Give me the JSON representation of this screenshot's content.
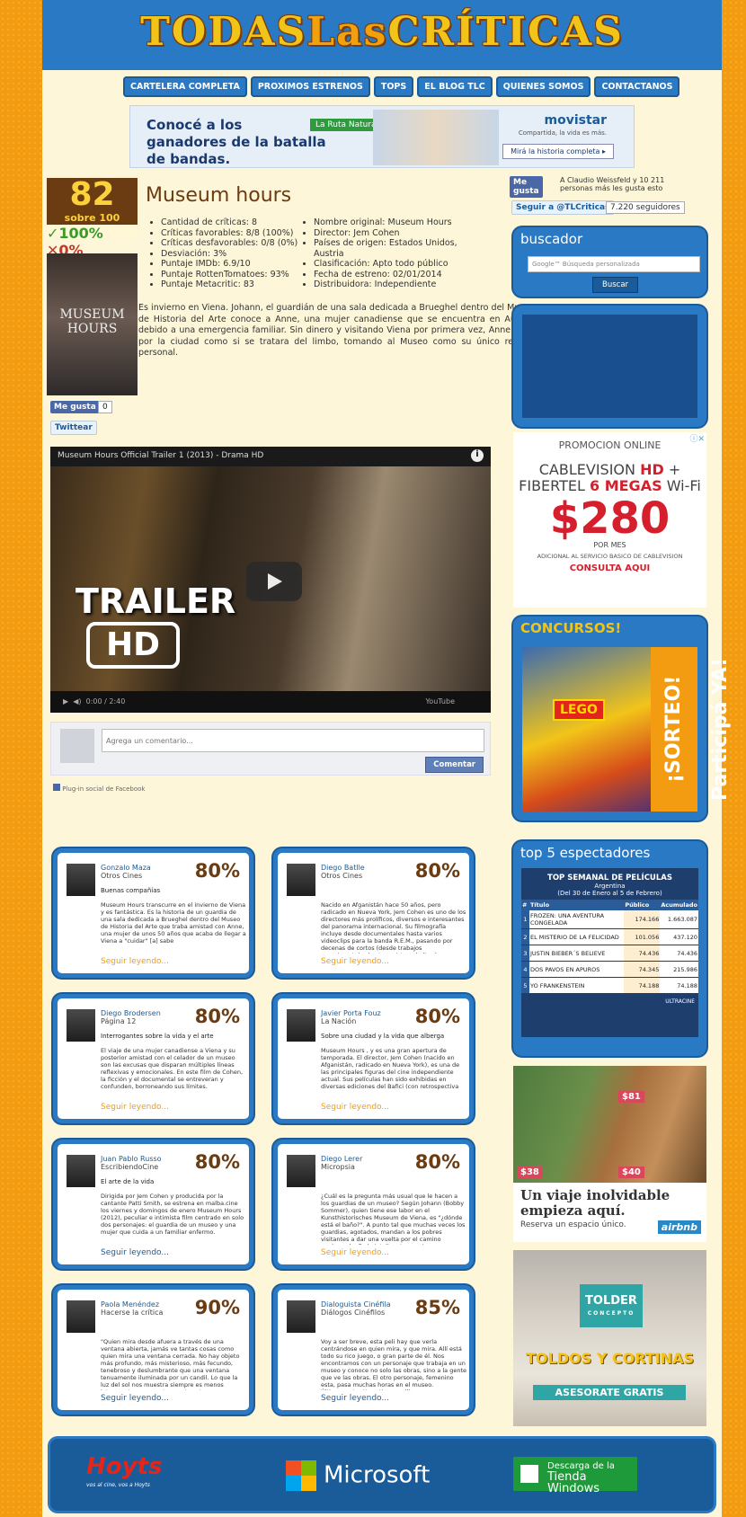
{
  "site": {
    "logo_a": "TODAS",
    "logo_b": "Las",
    "logo_c": "CRÍTICAS"
  },
  "nav": [
    "CARTELERA COMPLETA",
    "PROXIMOS ESTRENOS",
    "TOPS",
    "EL BLOG TLC",
    "QUIENES SOMOS",
    "CONTACTANOS"
  ],
  "banner": {
    "text": "Conocé a los ganadores de la batalla de bandas.",
    "ruta": "La Ruta Natural",
    "brand": "movistar",
    "brand_sub": "Compartida, la vida es más.",
    "cta": "Mirá la historia completa ▸"
  },
  "movie": {
    "score": "82",
    "score_sub": "sobre 100",
    "fav": "✓100%",
    "unfav": "✕0%",
    "poster_title": "MUSEUM HOURS",
    "title": "Museum hours",
    "info_left": [
      "Cantidad de críticas: 8",
      "Críticas favorables: 8/8 (100%)",
      "Críticas desfavorables: 0/8 (0%)",
      "Desviación: 3%",
      "Puntaje IMDb: 6.9/10",
      "Puntaje RottenTomatoes: 93%",
      "Puntaje Metacritic: 83"
    ],
    "info_right": [
      "Nombre original: Museum Hours",
      "Director: Jem Cohen",
      "Países de origen: Estados Unidos, Austria",
      "Clasificación: Apto todo público",
      "Fecha de estreno: 02/01/2014",
      "Distribuidora: Independiente"
    ],
    "synopsis": "Es invierno en Viena. Johann, el guardián de una sala dedicada a Brueghel dentro del Museo de Historia del Arte conoce a Anne, una mujer canadiense que se encuentra en Austria debido a una emergencia familiar. Sin dinero y visitando Viena por primera vez, Anne vaga por la ciudad como si se tratara del limbo, tomando al Museo como su único refugio personal."
  },
  "social": {
    "like": "Me gusta",
    "like_count": "0",
    "tweet": "Twittear",
    "fb_text": "A Claudio Weissfeld y 10 211 personas más les gusta esto",
    "follow": "Seguir a @TLCriticas",
    "followers": "7.220 seguidores"
  },
  "video": {
    "title": "Museum Hours Official Trailer 1 (2013) - Drama HD",
    "big1": "TRAILER",
    "big2": "HD",
    "time": "0:00 / 2:40",
    "yt": "YouTube"
  },
  "comments": {
    "placeholder": "Agrega un comentario...",
    "button": "Comentar",
    "plugin": "Plug-in social de Facebook"
  },
  "reviews": [
    {
      "name": "Gonzalo Maza",
      "media": "Otros Cines",
      "score": "80%",
      "headline": "Buenas compañías",
      "text": "Museum Hours transcurre en el invierno de Viena y es fantástica. Es la historia de un guardia de una sala dedicada a Brueghel dentro del Museo de Historia del Arte que traba amistad con Anne, una mujer de unos 50 años que acaba de llegar a Viena a \"cuidar\" [a] sabe",
      "more": "Seguir leyendo..."
    },
    {
      "name": "Diego Batlle",
      "media": "Otros Cines",
      "score": "80%",
      "headline": "",
      "text": "Nacido en Afganistán hace 50 años, pero radicado en Nueva York, Jem Cohen es uno de los directores más prolíficos, diversos e interesantes del panorama internacional. Su filmografía incluye desde documentales hasta varios videoclips para la banda R.E.M., pasando por decenas de cortos (desde trabajos experimentales hasta registros dedicados a",
      "more": "Seguir leyendo..."
    },
    {
      "name": "Diego Brodersen",
      "media": "Página 12",
      "score": "80%",
      "headline": "Interrogantes sobre la vida y el arte",
      "text": "El viaje de una mujer canadiense a Viena y su posterior amistad con el celador de un museo son las excusas que disparan múltiples líneas reflexivas y emocionales. En este film de Cohen, la ficción y el documental se entreveran y confunden, borroneando sus límites.",
      "more": "Seguir leyendo..."
    },
    {
      "name": "Javier Porta Fouz",
      "media": "La Nación",
      "score": "80%",
      "headline": "Sobre una ciudad y la vida que alberga",
      "text": "Museum Hours , y es una gran apertura de temporada. El director, Jem Cohen (nacido en Afganistán, radicado en Nueva York), es una de las principales figuras del cine independiente actual. Sus películas han sido exhibidas en diversas ediciones del Bafici (con retrospectiva",
      "more": "Seguir leyendo..."
    },
    {
      "name": "Juan Pablo Russo",
      "media": "EscribiendoCine",
      "score": "80%",
      "headline": "El arte de la vida",
      "text": "Dirigida por Jem Cohen y producida por la cantante Patti Smith, se estrena en malba.cine los viernes y domingos de enero Museum Hours (2012), peculiar e intimista film centrado en solo dos personajes: el guardia de un museo y una mujer que cuida a un familiar enfermo.",
      "more": "Seguir leyendo..."
    },
    {
      "name": "Diego Lerer",
      "media": "Micropsia",
      "score": "80%",
      "headline": "",
      "text": "¿Cuál es la pregunta más usual que le hacen a los guardias de un museo? Según Johann (Bobby Sommer), quien tiene ese labor en el Kunsthistorisches Museum de Viena, es \"¿dónde está el baño?\". A punto tal que muchas veces los guardias, agotados, mandan a los pobres visitantes a dar una vuelta por el camino equivocado. En la inteligente y curiosa",
      "more": "Seguir leyendo..."
    },
    {
      "name": "Paola Menéndez",
      "media": "Hacerse la crítica",
      "score": "90%",
      "headline": "",
      "text": "\"Quien mira desde afuera a través de una ventana abierta, jamás ve tantas cosas como quien mira una ventana cerrada. No hay objeto más profundo, más misterioso, más fecundo, tenebroso y deslumbrante que una ventana tenuamente iluminada por un candil. Lo que la luz del sol nos muestra siempre es menos interesante que cuanto acontece tras unos",
      "more": "Seguir leyendo..."
    },
    {
      "name": "Dialoguista Cinéfila",
      "media": "Diálogos Cinéfilos",
      "score": "85%",
      "headline": "",
      "text": "Voy a ser breve, esta peli hay que verla centrándose en quien mira, y que mira. Allí está todo su rico juego, o gran parte de él. Nos encontramos con un personaje que trabaja en un museo y conoce no solo las obras, sino a la gente que ve las obras. El otro personaje, femenino esta, pasa muchas horas en el museo. Últimamente. Hace tiempo allí, se arma una",
      "more": "Seguir leyendo..."
    }
  ],
  "search": {
    "title": "buscador",
    "placeholder": "Google™ Búsqueda personalizada",
    "button": "Buscar"
  },
  "cable_ad": {
    "promo": "PROMOCION ONLINE",
    "line1": "CABLEVISION",
    "hd": "HD",
    "plus": "+",
    "line2": "FIBERTEL",
    "megas": "6 MEGAS",
    "wifi": "Wi-Fi",
    "price": "$280",
    "permes": "POR MES",
    "adic": "ADICIONAL AL SERVICIO BASICO DE CABLEVISION",
    "consulta": "CONSULTA AQUI"
  },
  "contest": {
    "title": "CONCURSOS!",
    "sorteo": "¡SORTEO! Participá YA!",
    "movie": "LEGO"
  },
  "top5": {
    "title": "top 5 espectadores",
    "header": "TOP SEMANAL DE PELÍCULAS",
    "country": "Argentina",
    "range": "(Del 30 de Enero al 5 de Febrero)",
    "cols": [
      "#",
      "Título",
      "Público",
      "Acumulado"
    ],
    "rows": [
      [
        "1",
        "FROZEN: UNA AVENTURA CONGELADA",
        "174.166",
        "1.663.087"
      ],
      [
        "2",
        "EL MISTERIO DE LA FELICIDAD",
        "101.056",
        "437.120"
      ],
      [
        "3",
        "JUSTIN BIEBER´S BELIEVE",
        "74.436",
        "74.436"
      ],
      [
        "4",
        "DOS PAVOS EN APUROS",
        "74.345",
        "215.986"
      ],
      [
        "5",
        "YO FRANKENSTEIN",
        "74.188",
        "74.188"
      ]
    ],
    "source": "ULTRACINE"
  },
  "airbnb": {
    "p1": "$81",
    "p2": "$38",
    "p3": "$40",
    "title": "Un viaje inolvidable empieza aquí.",
    "sub": "Reserva un espacio único.",
    "brand": "airbnb"
  },
  "tolder": {
    "name": "TOLDER",
    "sub": "CONCEPTO",
    "title": "TOLDOS Y CORTINAS",
    "cta": "ASESORATE GRATIS"
  },
  "footer": {
    "hoyts": "Hoyts",
    "hoyts_sub": "vos al cine, vos a Hoyts",
    "ms": "Microsoft",
    "store1": "Descarga de la",
    "store2": "Tienda Windows"
  },
  "colors": {
    "primary": "#2a79c4",
    "brown": "#6b3b12",
    "orange": "#f39c12"
  }
}
